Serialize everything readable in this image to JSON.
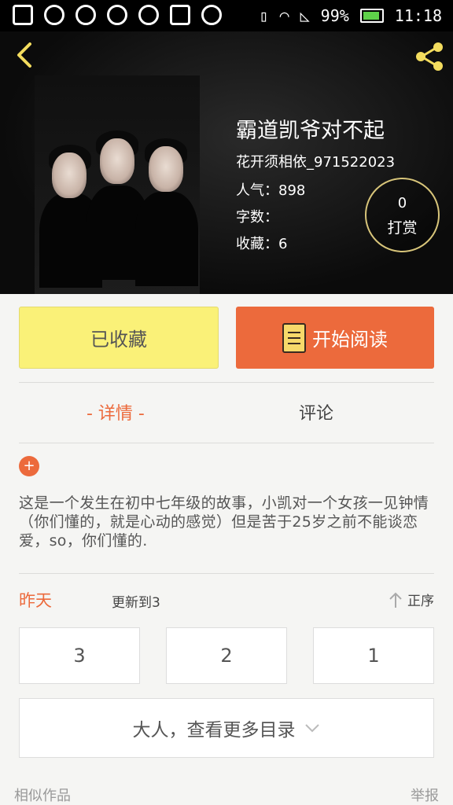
{
  "status_bar": {
    "battery": "99%",
    "time": "11:18"
  },
  "book": {
    "title": "霸道凯爷对不起",
    "author": "花开须相依_971522023",
    "popularity_label": "人气：",
    "popularity": "898",
    "word_count_label": "字数：",
    "word_count": "",
    "favorites_label": "收藏：",
    "favorites": "6"
  },
  "tip": {
    "count": "0",
    "label": "打赏"
  },
  "actions": {
    "favorited_label": "已收藏",
    "start_reading_label": "开始阅读"
  },
  "tabs": {
    "detail": "- 详情 -",
    "comment": "评论"
  },
  "description": {
    "expand_symbol": "+",
    "text": "这是一个发生在初中七年级的故事，小凯对一个女孩一见钟情（你们懂的，就是心动的感觉）但是苦于25岁之前不能谈恋爱，so，你们懂的."
  },
  "updates": {
    "day": "昨天",
    "text": "更新到3",
    "order_label": "正序"
  },
  "chapters": [
    "3",
    "2",
    "1"
  ],
  "more_catalog_label": "大人，查看更多目录",
  "footer": {
    "similar_works": "相似作品",
    "report": "举报"
  },
  "colors": {
    "accent": "#ec6a3c",
    "favorite_button": "#faf178",
    "header_bg": "#000000"
  },
  "icons": [
    "back-arrow-icon",
    "share-icon",
    "book-icon",
    "plus-icon",
    "up-arrow-icon",
    "chevron-down-icon"
  ]
}
